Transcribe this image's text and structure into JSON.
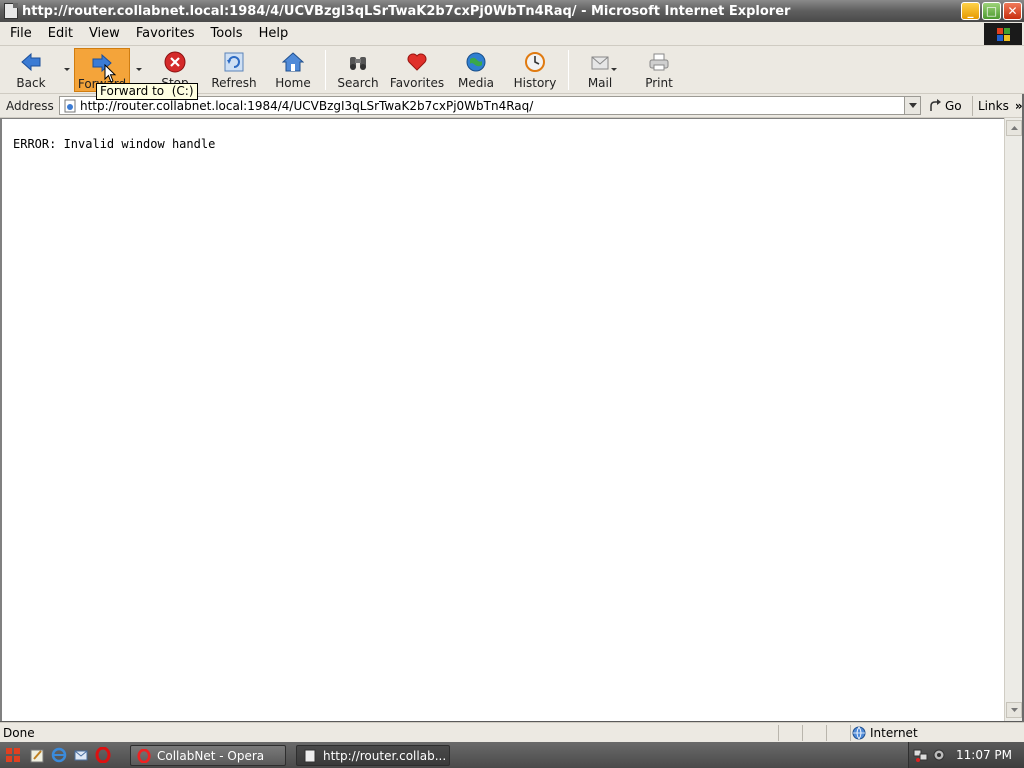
{
  "window": {
    "title": "http://router.collabnet.local:1984/4/UCVBzgI3qLSrTwaK2b7cxPj0WbTn4Raq/ - Microsoft Internet Explorer",
    "minimize_glyph": "_",
    "maximize_glyph": "□",
    "close_glyph": "✕"
  },
  "menubar": {
    "items": [
      "File",
      "Edit",
      "View",
      "Favorites",
      "Tools",
      "Help"
    ]
  },
  "toolbar": {
    "back_label": "Back",
    "forward_label": "Forward",
    "stop_label": "Stop",
    "refresh_label": "Refresh",
    "home_label": "Home",
    "search_label": "Search",
    "favorites_label": "Favorites",
    "media_label": "Media",
    "history_label": "History",
    "mail_label": "Mail",
    "print_label": "Print",
    "tooltip": "Forward to  (C:)"
  },
  "addressbar": {
    "label": "Address",
    "url": "http://router.collabnet.local:1984/4/UCVBzgI3qLSrTwaK2b7cxPj0WbTn4Raq/",
    "go_label": "Go",
    "links_label": "Links",
    "links_chevron": "»"
  },
  "content": {
    "error_text": "ERROR: Invalid window handle"
  },
  "statusbar": {
    "status": "Done",
    "zone": "Internet"
  },
  "taskbar": {
    "tasks": [
      {
        "label": "CollabNet - Opera",
        "icon": "opera-icon"
      },
      {
        "label": "http://router.collab...",
        "icon": "ie-page-icon"
      }
    ],
    "clock": "11:07 PM"
  },
  "colors": {
    "titlebar": "#5e5e5e",
    "chrome": "#ece9e2",
    "hover_button": "#f4a43a",
    "tooltip_bg": "#ffffe1"
  }
}
